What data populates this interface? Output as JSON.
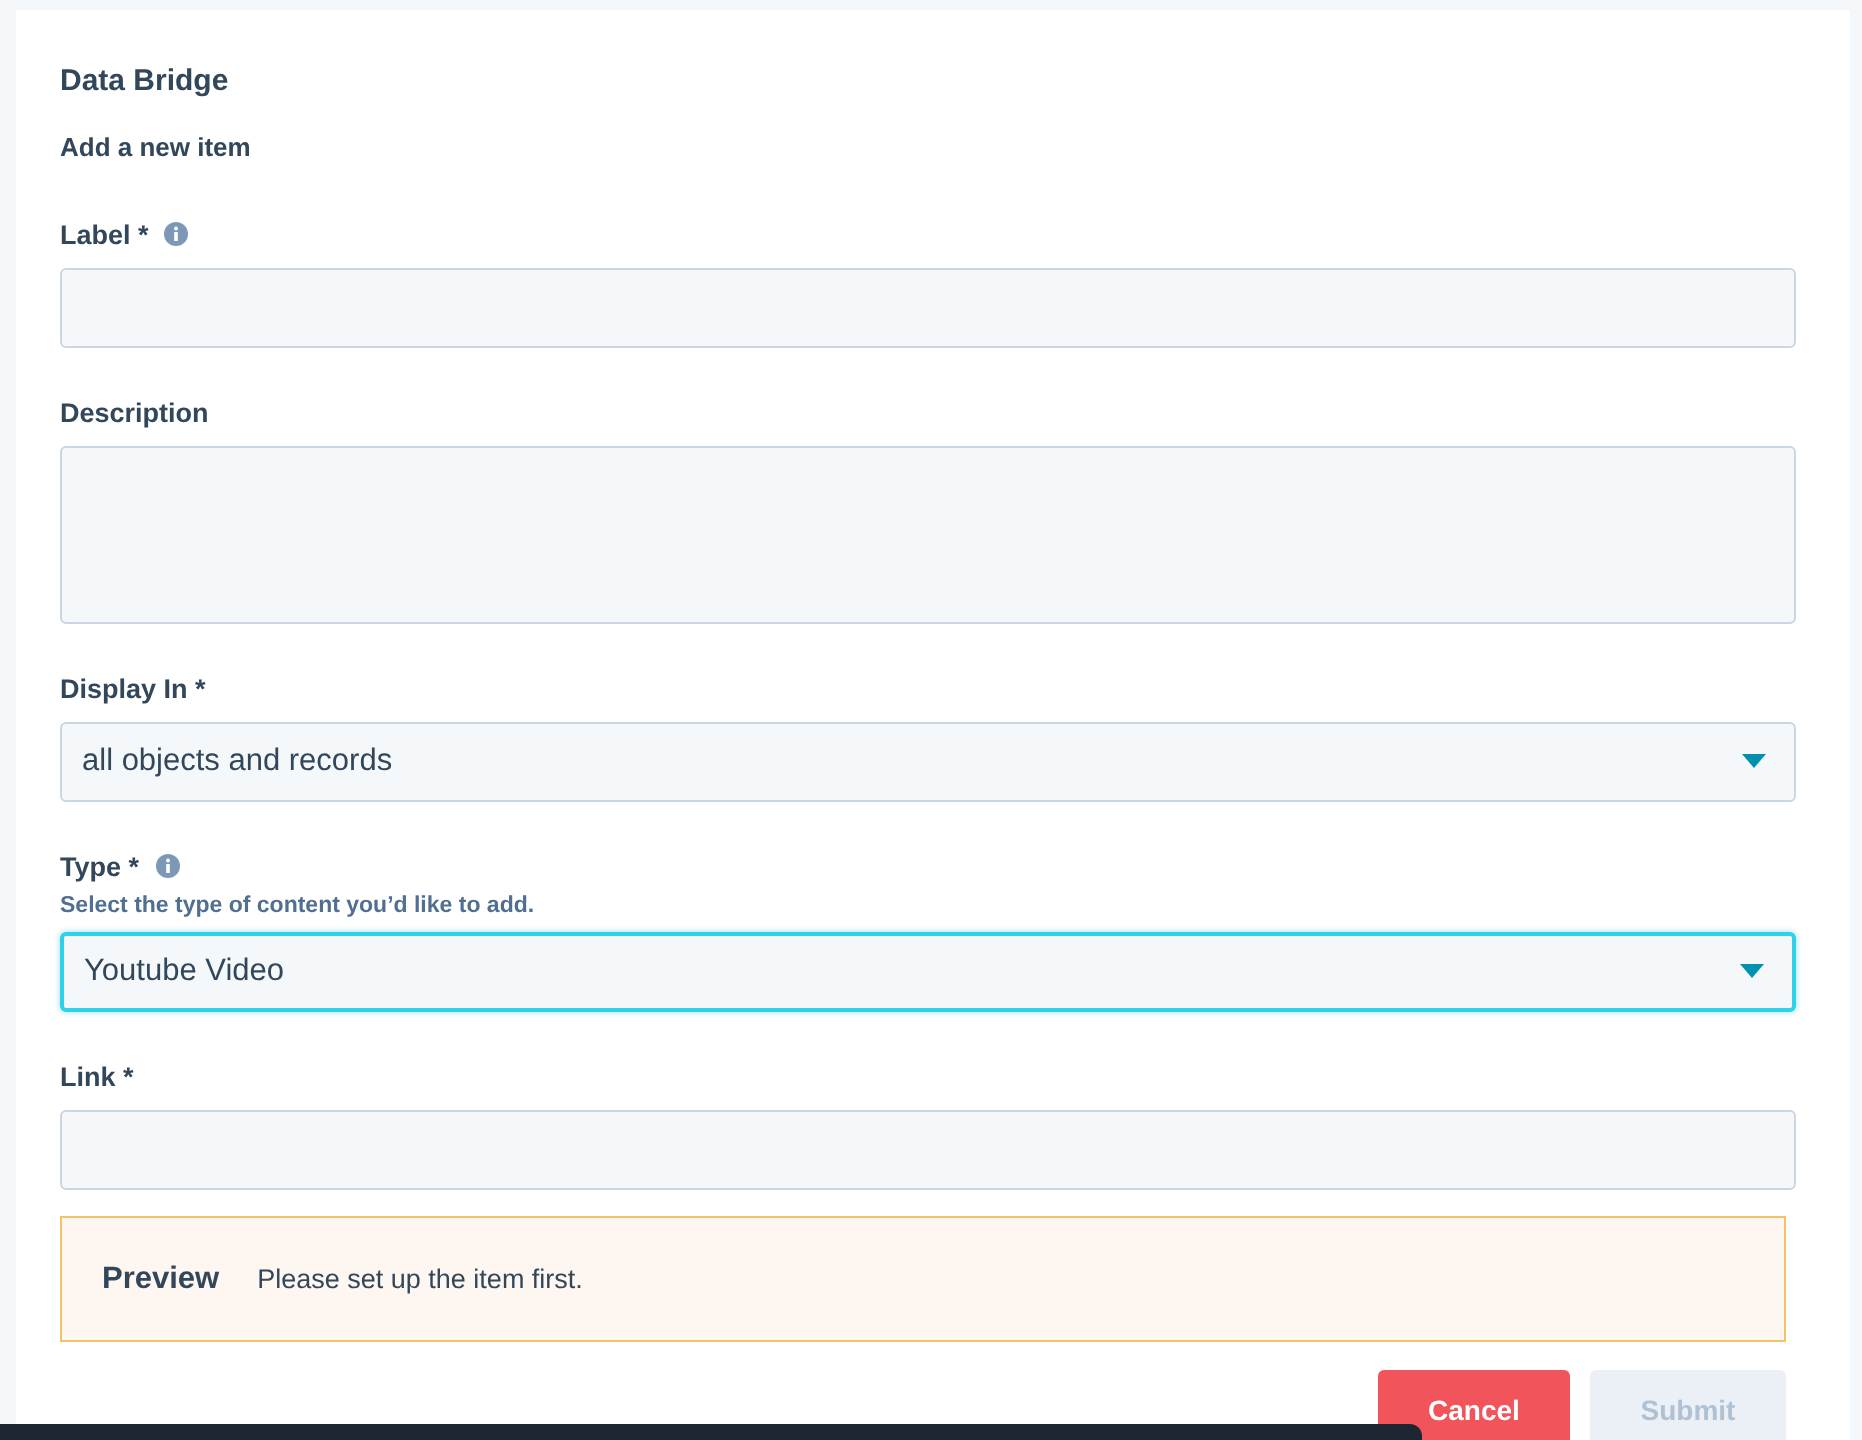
{
  "title": "Data Bridge",
  "subtitle": "Add a new item",
  "fields": [
    {
      "kind": "text",
      "label": "Label *",
      "info": true,
      "focused": false
    },
    {
      "kind": "textarea",
      "label": "Description",
      "info": false,
      "focused": false
    },
    {
      "kind": "select",
      "label": "Display In *",
      "info": false,
      "value": "all objects and records",
      "focused": false
    },
    {
      "kind": "select",
      "label": "Type *",
      "info": true,
      "help": "Select the type of content you’d like to add.",
      "value": "Youtube Video",
      "focused": true
    },
    {
      "kind": "text",
      "label": "Link *",
      "info": false,
      "focused": false
    }
  ],
  "preview": {
    "title": "Preview",
    "message": "Please set up the item first."
  },
  "buttons": [
    {
      "label": "Cancel",
      "kind": "primary",
      "disabled": false
    },
    {
      "label": "Submit",
      "kind": "secondary",
      "disabled": true
    }
  ]
}
